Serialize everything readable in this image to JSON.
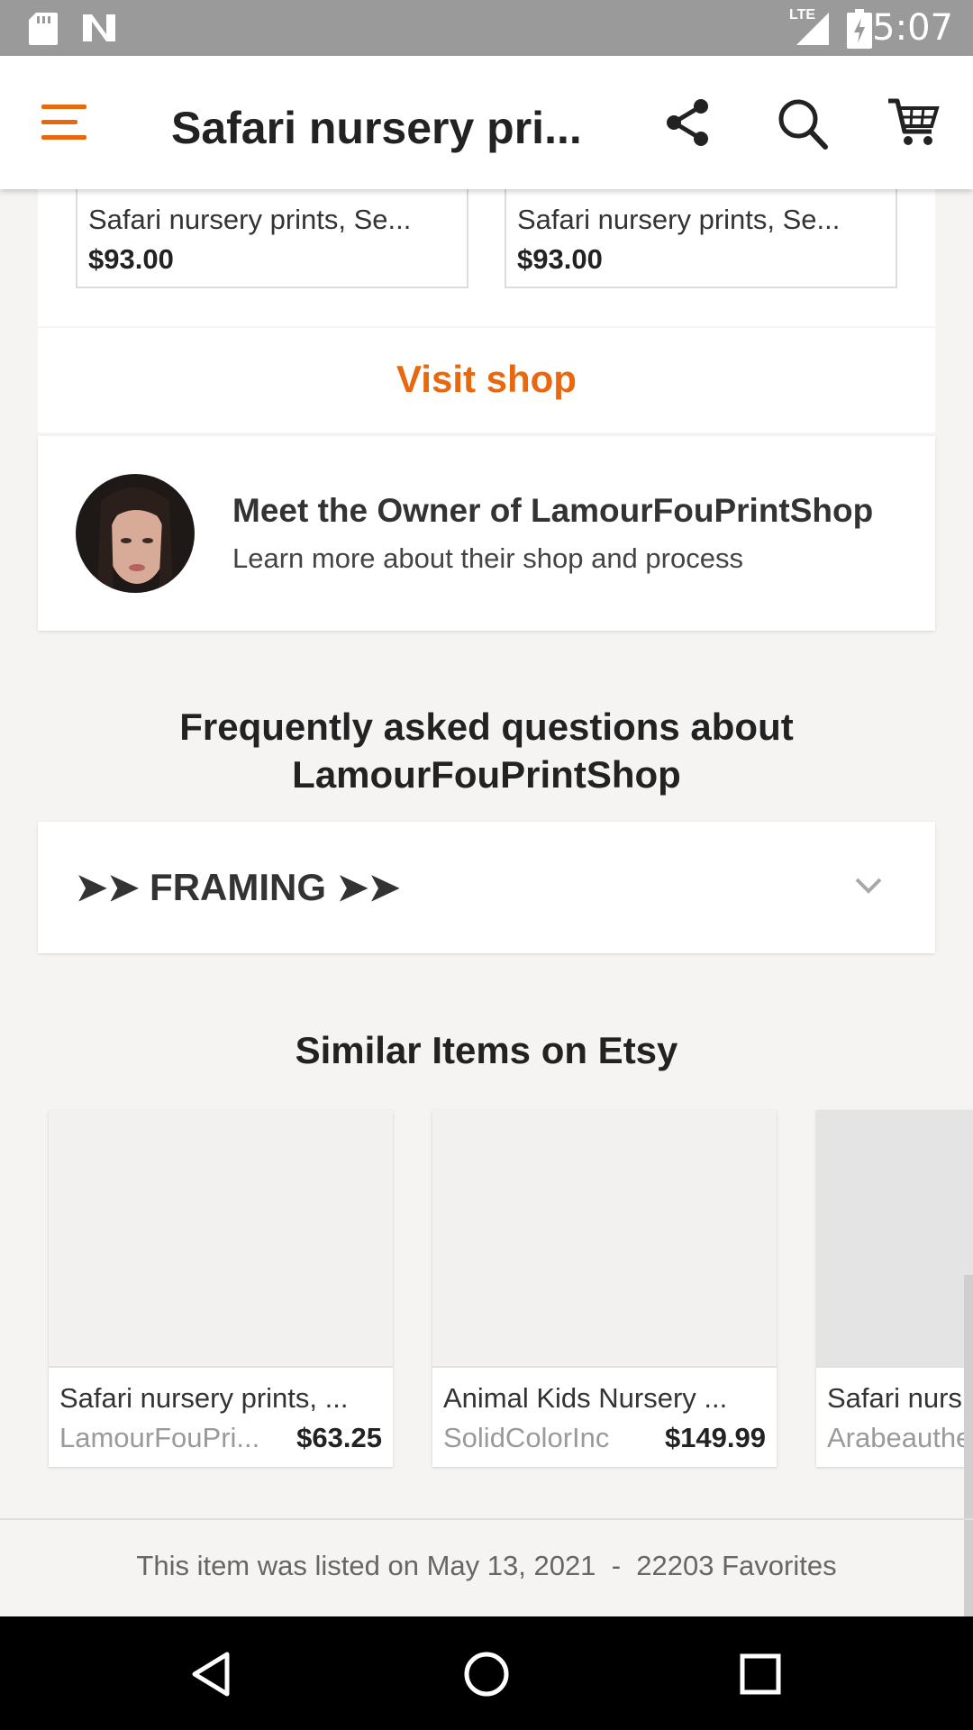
{
  "status_bar": {
    "time": "5:07",
    "network": "LTE"
  },
  "app_bar": {
    "title": "Safari nursery pri..."
  },
  "shop_listings": [
    {
      "title": "Safari nursery prints, Se...",
      "price": "$93.00"
    },
    {
      "title": "Safari nursery prints, Se...",
      "price": "$93.00"
    }
  ],
  "visit_shop_label": "Visit shop",
  "owner": {
    "heading": "Meet the Owner of LamourFouPrintShop",
    "subheading": "Learn more about their shop and process"
  },
  "faq": {
    "heading_line1": "Frequently asked questions about",
    "heading_line2": "LamourFouPrintShop",
    "items": [
      {
        "label": "➤➤ FRAMING ➤➤"
      }
    ]
  },
  "similar": {
    "heading": "Similar Items on Etsy",
    "items": [
      {
        "title": "Safari nursery prints, ...",
        "shop": "LamourFouPri...",
        "price": "$63.25"
      },
      {
        "title": "Animal Kids Nursery ...",
        "shop": "SolidColorInc",
        "price": "$149.99"
      },
      {
        "title": "Safari nurs",
        "shop": "Arabeauthe",
        "price": ""
      }
    ]
  },
  "footer": {
    "listed_prefix": "This item was listed on",
    "listed_date": "May 13, 2021",
    "separator": "-",
    "favorites_count": "22203",
    "favorites_label": "Favorites"
  },
  "colors": {
    "accent": "#e8680f",
    "status_bar": "#9a9a9a",
    "nav_bar": "#000000"
  },
  "icons": [
    "sd-card-icon",
    "n-logo-icon",
    "signal-icon",
    "battery-icon",
    "menu-icon",
    "share-icon",
    "search-icon",
    "cart-icon",
    "chevron-down-icon",
    "back-icon",
    "home-icon",
    "recents-icon"
  ]
}
